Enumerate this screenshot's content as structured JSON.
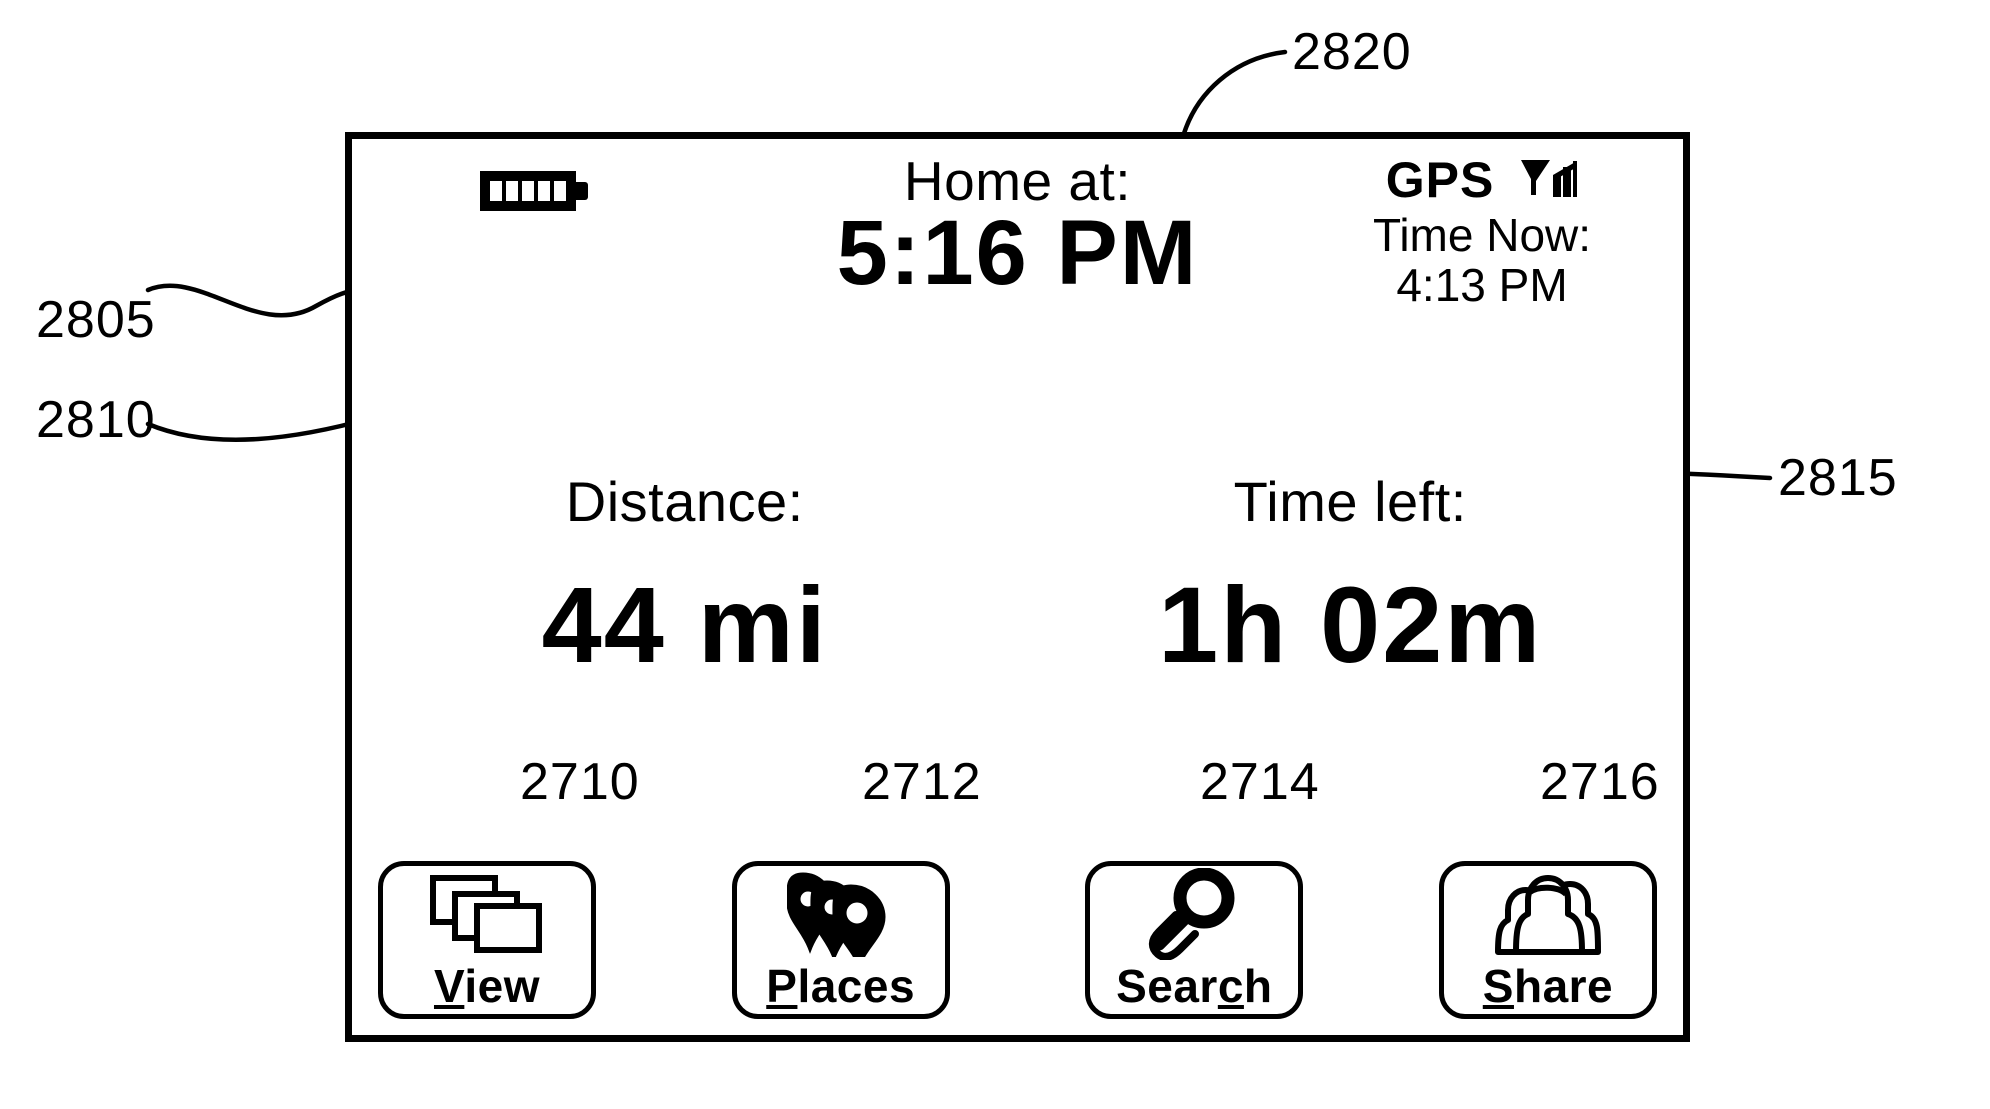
{
  "figure": {
    "type": "patent-figure",
    "description": "Navigation device display screen with status bar, trip metrics and four soft-key buttons"
  },
  "device": {
    "status_bar": {
      "battery_icon": "battery-icon",
      "battery_segments": 5,
      "home_at_label": "Home at:",
      "home_at_time": "5:16 PM",
      "gps_label": "GPS",
      "signal_icon": "signal-strength-icon",
      "time_now_label": "Time Now:",
      "time_now_value": "4:13 PM"
    },
    "metrics": [
      {
        "label": "Distance:",
        "value": "44 mi",
        "name": "distance"
      },
      {
        "label": "Time left:",
        "value": "1h 02m",
        "name": "time-left"
      }
    ],
    "buttons": [
      {
        "label": "View",
        "accel": "V",
        "icon": "windows-stack-icon",
        "name": "view"
      },
      {
        "label": "Places",
        "accel": "P",
        "icon": "map-pins-icon",
        "name": "places"
      },
      {
        "label": "Search",
        "accel": "c",
        "icon": "magnifier-icon",
        "name": "search"
      },
      {
        "label": "Share",
        "accel": "S",
        "icon": "people-group-icon",
        "name": "share"
      }
    ]
  },
  "reference_numerals": {
    "screen": "2805",
    "distance_field": "2810",
    "time_left_field": "2815",
    "eta_field": "2820",
    "view_button": "2710",
    "places_button": "2712",
    "search_button": "2714",
    "share_button": "2716"
  },
  "colors": {
    "ink": "#000000",
    "paper": "#ffffff"
  }
}
